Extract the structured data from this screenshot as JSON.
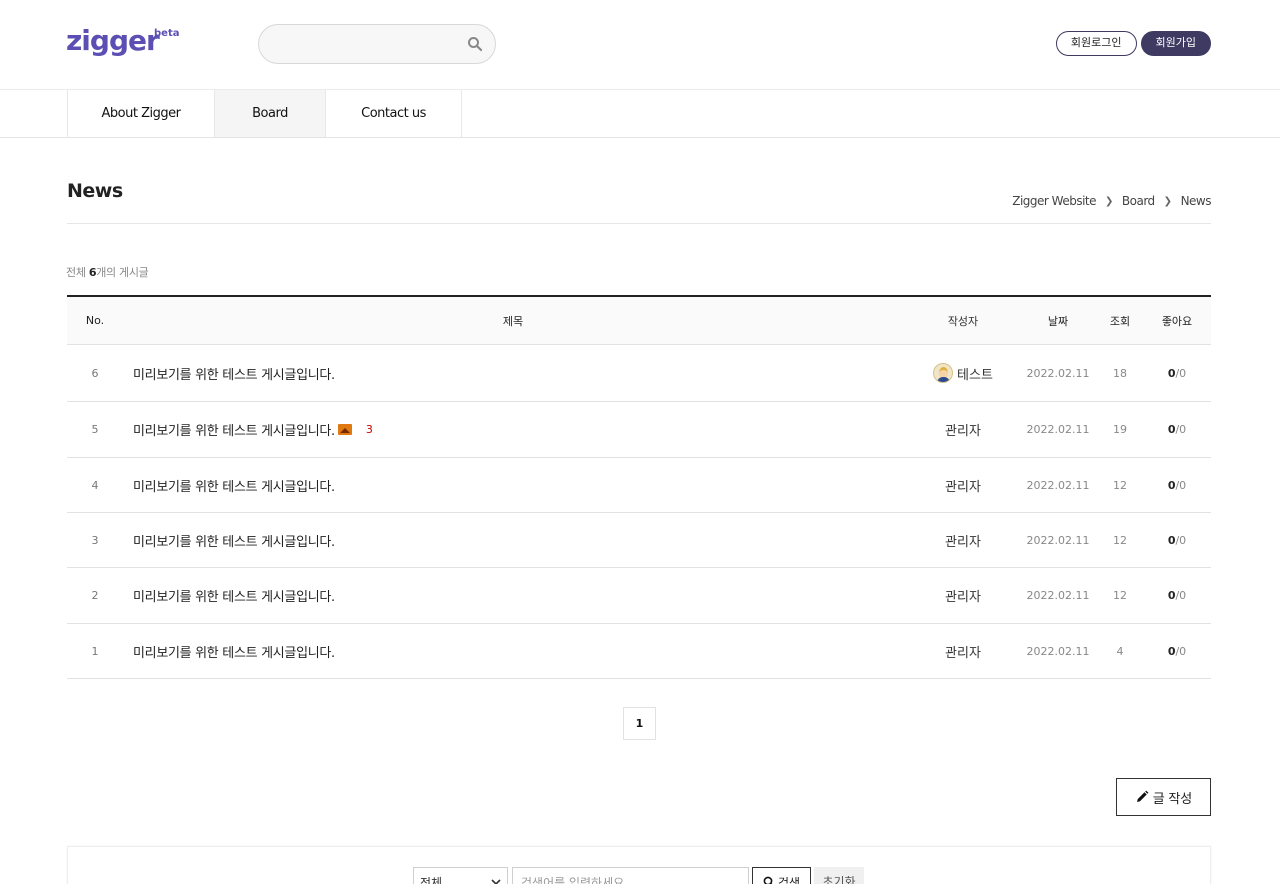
{
  "header": {
    "logo_text": "zigger",
    "logo_sup": "beta",
    "search_placeholder": "",
    "login_label": "회원로그인",
    "join_label": "회원가입"
  },
  "nav": {
    "items": [
      "About Zigger",
      "Board",
      "Contact us"
    ],
    "active": "Board"
  },
  "page": {
    "title": "News",
    "breadcrumb": [
      "Zigger Website",
      "Board",
      "News"
    ],
    "total_prefix": "전체 ",
    "total_count": "6",
    "total_suffix": "개의 게시글"
  },
  "table": {
    "headers": {
      "no": "No.",
      "subject": "제목",
      "writer": "작성자",
      "date": "날짜",
      "hit": "조회",
      "like": "좋아요"
    },
    "rows": [
      {
        "no": "6",
        "subject": "미리보기를 위한 테스트 게시글입니다.",
        "writer": "테스트",
        "date": "2022.02.11",
        "hit": "18",
        "like": "0",
        "unlike": "/0"
      },
      {
        "no": "5",
        "subject": "미리보기를 위한 테스트 게시글입니다.",
        "writer": "관리자",
        "date": "2022.02.11",
        "hit": "19",
        "like": "0",
        "unlike": "/0",
        "comments": "3"
      },
      {
        "no": "4",
        "subject": "미리보기를 위한 테스트 게시글입니다.",
        "writer": "관리자",
        "date": "2022.02.11",
        "hit": "12",
        "like": "0",
        "unlike": "/0"
      },
      {
        "no": "3",
        "subject": "미리보기를 위한 테스트 게시글입니다.",
        "writer": "관리자",
        "date": "2022.02.11",
        "hit": "12",
        "like": "0",
        "unlike": "/0"
      },
      {
        "no": "2",
        "subject": "미리보기를 위한 테스트 게시글입니다.",
        "writer": "관리자",
        "date": "2022.02.11",
        "hit": "12",
        "like": "0",
        "unlike": "/0"
      },
      {
        "no": "1",
        "subject": "미리보기를 위한 테스트 게시글입니다.",
        "writer": "관리자",
        "date": "2022.02.11",
        "hit": "4",
        "like": "0",
        "unlike": "/0"
      }
    ]
  },
  "pagination": {
    "current": "1"
  },
  "write_button_label": "글 작성",
  "bottom_search": {
    "select_value": "전체",
    "input_placeholder": "검색어를 입력하세요",
    "search_label": "검색",
    "reset_label": "초기화"
  },
  "icons": {
    "search": "search-icon",
    "pencil": "pencil-icon",
    "image": "image-icon",
    "chevron": "chevron-down-icon"
  },
  "colors": {
    "brand": "#5b4fb4",
    "join_button": "#3e3a62",
    "comment_count": "#cc0000"
  }
}
